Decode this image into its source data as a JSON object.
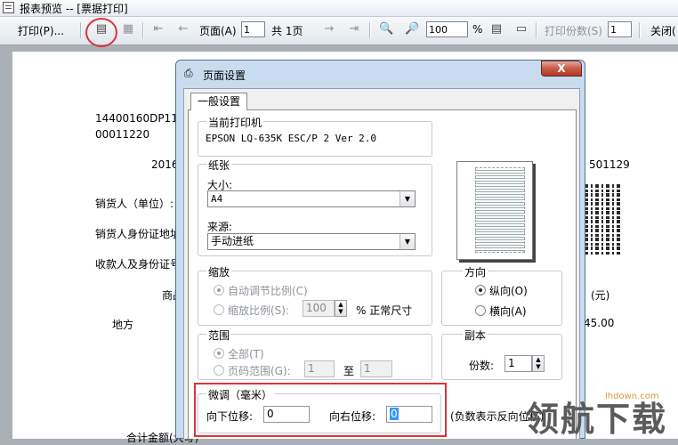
{
  "window": {
    "title": "报表预览 -- [票据打印]"
  },
  "toolbar": {
    "print_label": "打印(P)...",
    "page_label": "页面(A)",
    "page_value": "1",
    "total_label": "共 1页",
    "zoom_value": "100",
    "percent_label": "%",
    "copies_label": "打印份数(S)",
    "copies_value": "1",
    "close_label": "关闭("
  },
  "document": {
    "code1": "14400160DP11",
    "code2": "00011220",
    "date_fragment": "2016",
    "number_fragment": "501129",
    "seller_label": "销货人（单位）:",
    "seller_address_label": "销货人身份证地址",
    "payee_id_label": "收款人及身份证号",
    "goods_label": "商品",
    "unit_label": "(元)",
    "place_label": "地方",
    "amount_value": "45.00",
    "total_caps_label": "合计金额(大写)"
  },
  "dialog": {
    "title": "页面设置",
    "close_label": "X",
    "tab_general": "一般设置",
    "printer": {
      "legend": "当前打印机",
      "name": "EPSON LQ-635K ESC/P 2 Ver 2.0"
    },
    "paper": {
      "legend": "纸张",
      "size_label": "大小:",
      "size_value": "A4",
      "source_label": "来源:",
      "source_value": "手动进纸"
    },
    "scale": {
      "legend": "缩放",
      "auto_label": "自动调节比例(C)",
      "ratio_label": "缩放比例(S):",
      "ratio_value": "100",
      "normal_size_label": "% 正常尺寸"
    },
    "range": {
      "legend": "范围",
      "all_label": "全部(T)",
      "pages_label": "页码范围(G):",
      "from_value": "1",
      "to_label": "至",
      "to_value": "1"
    },
    "orientation": {
      "legend": "方向",
      "portrait_label": "纵向(O)",
      "landscape_label": "横向(A)"
    },
    "copies": {
      "legend": "副本",
      "count_label": "份数:",
      "count_value": "1"
    },
    "offset": {
      "legend": "微调（毫米）",
      "down_label": "向下位移:",
      "down_value": "0",
      "right_label": "向右位移:",
      "right_value": "0",
      "hint": "(负数表示反向位移)"
    }
  },
  "watermark": {
    "text": "领航下载",
    "site": "lhdown.com"
  }
}
